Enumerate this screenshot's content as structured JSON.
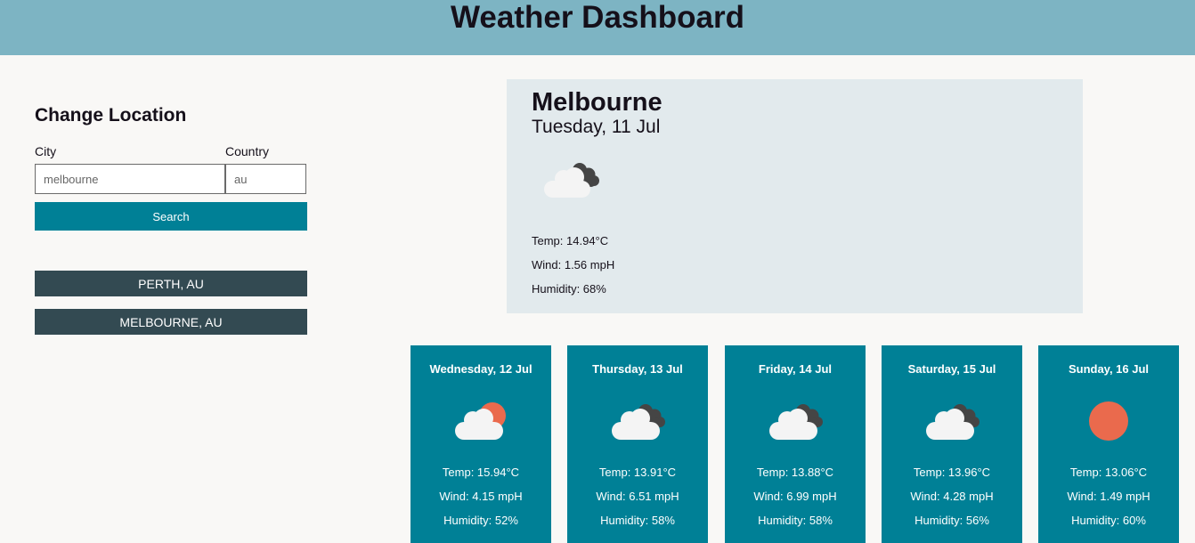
{
  "header": {
    "title": "Weather Dashboard"
  },
  "search": {
    "heading": "Change Location",
    "city_label": "City",
    "country_label": "Country",
    "city_value": "melbourne",
    "country_value": "au",
    "search_label": "Search"
  },
  "history": [
    "PERTH, AU",
    "MELBOURNE, AU"
  ],
  "current": {
    "city": "Melbourne",
    "date": "Tuesday, 11 Jul",
    "icon": "cloud-dark-icon",
    "temp": "Temp: 14.94°C",
    "wind": "Wind: 1.56 mpH",
    "humidity": "Humidity: 68%"
  },
  "forecast": [
    {
      "date": "Wednesday, 12 Jul",
      "icon": "cloud-sun-icon",
      "temp": "Temp: 15.94°C",
      "wind": "Wind: 4.15 mpH",
      "humidity": "Humidity: 52%"
    },
    {
      "date": "Thursday, 13 Jul",
      "icon": "cloud-dark-icon",
      "temp": "Temp: 13.91°C",
      "wind": "Wind: 6.51 mpH",
      "humidity": "Humidity: 58%"
    },
    {
      "date": "Friday, 14 Jul",
      "icon": "cloud-dark-icon",
      "temp": "Temp: 13.88°C",
      "wind": "Wind: 6.99 mpH",
      "humidity": "Humidity: 58%"
    },
    {
      "date": "Saturday, 15 Jul",
      "icon": "cloud-dark-icon",
      "temp": "Temp: 13.96°C",
      "wind": "Wind: 4.28 mpH",
      "humidity": "Humidity: 56%"
    },
    {
      "date": "Sunday, 16 Jul",
      "icon": "sun-icon",
      "temp": "Temp: 13.06°C",
      "wind": "Wind: 1.49 mpH",
      "humidity": "Humidity: 60%"
    }
  ],
  "colors": {
    "header_bg": "#7db4c3",
    "accent": "#008096",
    "history_bg": "#334a52",
    "current_bg": "#e2eaed",
    "sun": "#ea6a4d"
  }
}
